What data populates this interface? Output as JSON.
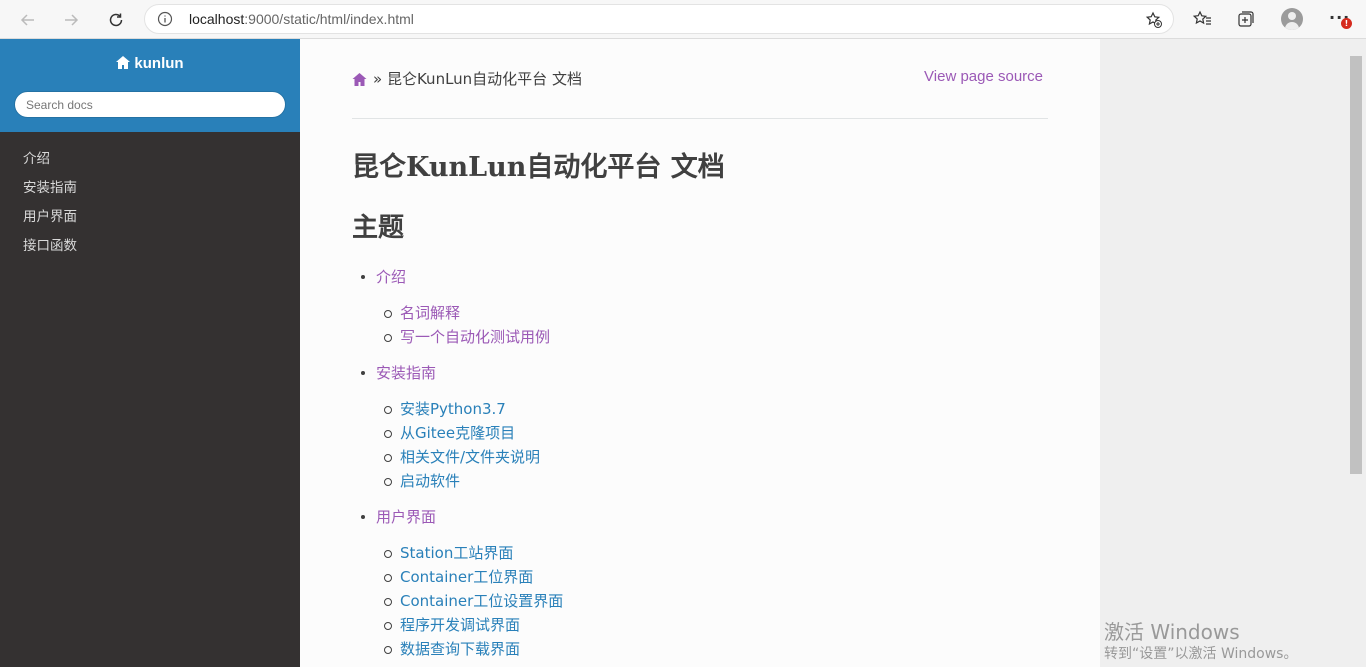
{
  "browser": {
    "url_host": "localhost",
    "url_rest": ":9000/static/html/index.html"
  },
  "sidebar": {
    "brand": "kunlun",
    "search_placeholder": "Search docs",
    "items": [
      {
        "label": "介绍"
      },
      {
        "label": "安装指南"
      },
      {
        "label": "用户界面"
      },
      {
        "label": "接口函数"
      }
    ]
  },
  "main": {
    "breadcrumb_sep": "»",
    "breadcrumb_current": "昆仑KunLun自动化平台 文档",
    "view_source": "View page source",
    "title": "昆仑KunLun自动化平台 文档",
    "section_title": "主题",
    "toc": [
      {
        "label": "介绍",
        "children": [
          {
            "label": "名词解释"
          },
          {
            "label": "写一个自动化测试用例"
          }
        ]
      },
      {
        "label": "安装指南",
        "children": [
          {
            "label": "安装Python3.7"
          },
          {
            "label": "从Gitee克隆项目"
          },
          {
            "label": "相关文件/文件夹说明"
          },
          {
            "label": "启动软件"
          }
        ]
      },
      {
        "label": "用户界面",
        "children": [
          {
            "label": "Station工站界面"
          },
          {
            "label": "Container工位界面"
          },
          {
            "label": "Container工位设置界面"
          },
          {
            "label": "程序开发调试界面"
          },
          {
            "label": "数据查询下载界面"
          }
        ]
      }
    ]
  },
  "watermark": {
    "line1": "激活 Windows",
    "line2": "转到“设置”以激活 Windows。"
  },
  "colors": {
    "sidebar_top": "#2980b9",
    "sidebar_bg": "#343131",
    "link_visited": "#9b59b6",
    "link": "#2980b9"
  }
}
